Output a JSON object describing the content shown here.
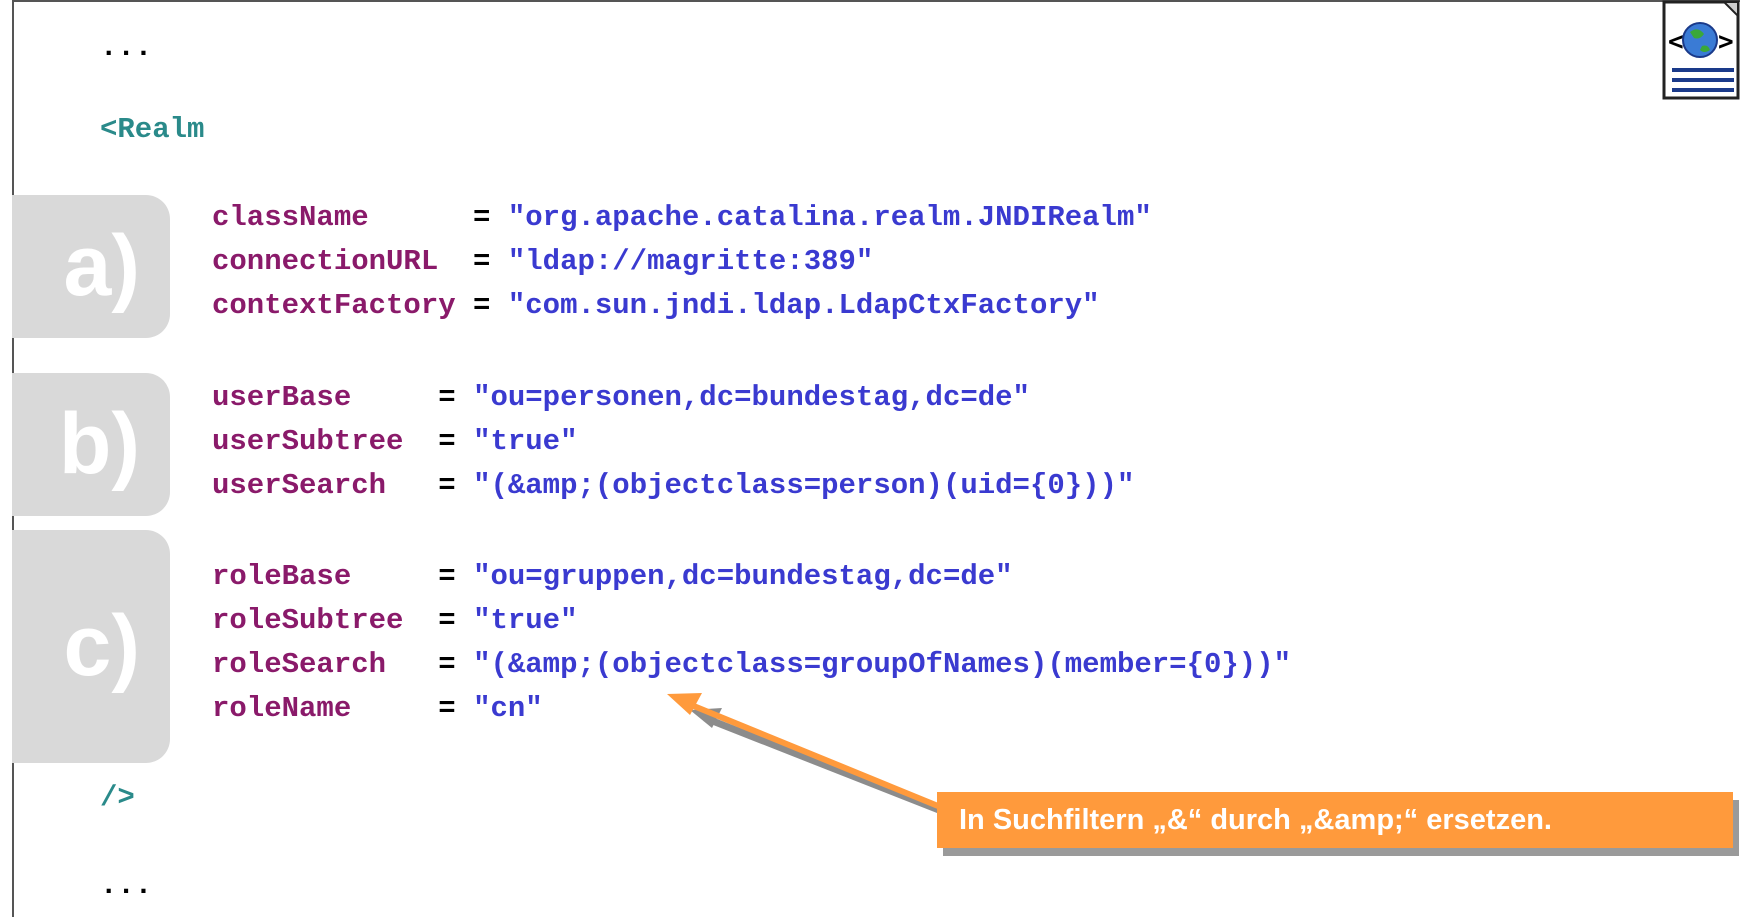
{
  "lines": {
    "ellipsis_top": "...",
    "realm_open": "<Realm",
    "realm_close": "/>",
    "ellipsis_bottom": "..."
  },
  "badges": {
    "a": "a)",
    "b": "b)",
    "c": "c)"
  },
  "attributes": [
    {
      "name": "className     ",
      "eq": " = ",
      "value": "\"org.apache.catalina.realm.JNDIRealm\""
    },
    {
      "name": "connectionURL ",
      "eq": " = ",
      "value": "\"ldap://magritte:389\""
    },
    {
      "name": "contextFactory",
      "eq": " = ",
      "value": "\"com.sun.jndi.ldap.LdapCtxFactory\""
    },
    {
      "name": "userBase    ",
      "eq": " = ",
      "value": "\"ou=personen,dc=bundestag,dc=de\""
    },
    {
      "name": "userSubtree ",
      "eq": " = ",
      "value": "\"true\""
    },
    {
      "name": "userSearch  ",
      "eq": " = ",
      "value": "\"(&amp;(objectclass=person)(uid={0}))\""
    },
    {
      "name": "roleBase    ",
      "eq": " = ",
      "value": "\"ou=gruppen,dc=bundestag,dc=de\""
    },
    {
      "name": "roleSubtree ",
      "eq": " = ",
      "value": "\"true\""
    },
    {
      "name": "roleSearch  ",
      "eq": " = ",
      "value": "\"(&amp;(objectclass=groupOfNames)(member={0}))\""
    },
    {
      "name": "roleName    ",
      "eq": " = ",
      "value": "\"cn\""
    }
  ],
  "callout": {
    "text": "In Suchfiltern „&“ durch „&amp;“ ersetzen."
  },
  "icon": "web-page-globe-icon",
  "colors": {
    "accent": "#ff9a3c",
    "attribute": "#8a1a6a",
    "value": "#3a3ad0",
    "tag": "#2a8a8a"
  }
}
